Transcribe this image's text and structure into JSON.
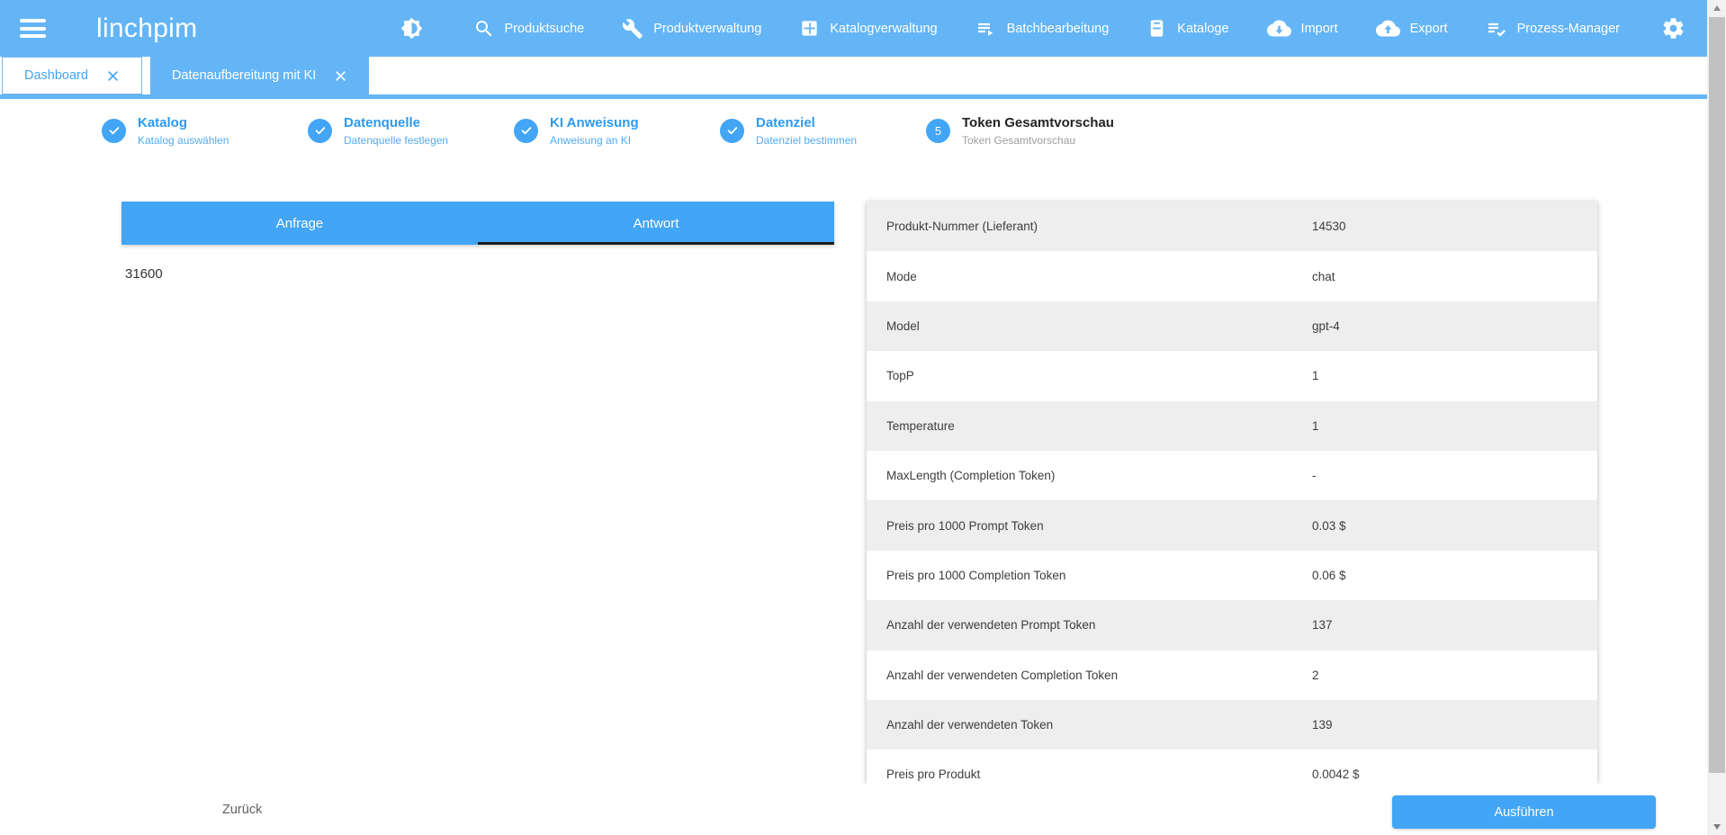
{
  "appbar": {
    "logo": "linchpim",
    "leading_icons": [
      {
        "icon": "menu-icon"
      },
      {
        "icon": "brightness-icon"
      }
    ],
    "items": [
      {
        "label": "Produktsuche",
        "icon": "search-icon"
      },
      {
        "label": "Produktverwaltung",
        "icon": "wrench-icon"
      },
      {
        "label": "Katalogverwaltung",
        "icon": "grid-icon"
      },
      {
        "label": "Batchbearbeitung",
        "icon": "batch-list-icon"
      },
      {
        "label": "Kataloge",
        "icon": "catalog-book-icon"
      },
      {
        "label": "Import",
        "icon": "cloud-download-icon"
      },
      {
        "label": "Export",
        "icon": "cloud-upload-icon"
      },
      {
        "label": "Prozess-Manager",
        "icon": "list-check-icon"
      }
    ],
    "trailing_icon": "settings-gear-icon"
  },
  "document_tabs": [
    {
      "label": "Dashboard",
      "active": false
    },
    {
      "label": "Datenaufbereitung mit KI",
      "active": true
    }
  ],
  "stepper": {
    "steps": [
      {
        "number": "1",
        "title": "Katalog",
        "subtitle": "Katalog auswählen",
        "state": "completed"
      },
      {
        "number": "2",
        "title": "Datenquelle",
        "subtitle": "Datenquelle festlegen",
        "state": "completed"
      },
      {
        "number": "3",
        "title": "KI Anweisung",
        "subtitle": "Anweisung an KI",
        "state": "completed"
      },
      {
        "number": "4",
        "title": "Datenziel",
        "subtitle": "Datenziel bestimmen",
        "state": "completed"
      },
      {
        "number": "5",
        "title": "Token Gesamtvorschau",
        "subtitle": "Token Gesamtvorschau",
        "state": "current"
      }
    ]
  },
  "preview_panel": {
    "tabs": [
      {
        "label": "Anfrage",
        "active": false
      },
      {
        "label": "Antwort",
        "active": true
      }
    ],
    "content": "31600"
  },
  "details_table": {
    "rows": [
      {
        "label": "Produkt-Nummer (Lieferant)",
        "value": "14530"
      },
      {
        "label": "Mode",
        "value": "chat"
      },
      {
        "label": "Model",
        "value": "gpt-4"
      },
      {
        "label": "TopP",
        "value": "1"
      },
      {
        "label": "Temperature",
        "value": "1"
      },
      {
        "label": "MaxLength (Completion Token)",
        "value": "-"
      },
      {
        "label": "Preis pro 1000 Prompt Token",
        "value": "0.03 $"
      },
      {
        "label": "Preis pro 1000 Completion Token",
        "value": "0.06 $"
      },
      {
        "label": "Anzahl der verwendeten Prompt Token",
        "value": "137"
      },
      {
        "label": "Anzahl der verwendeten Completion Token",
        "value": "2"
      },
      {
        "label": "Anzahl der verwendeten Token",
        "value": "139"
      },
      {
        "label": "Preis pro Produkt",
        "value": "0.0042 $"
      }
    ]
  },
  "footer": {
    "back_label": "Zurück",
    "run_label": "Ausführen"
  },
  "colors": {
    "appbar_blue": "#64b5f6",
    "accent_blue": "#42a5f5",
    "tab_ink": "#1c1c1c",
    "row_alt": "#eeeeee"
  }
}
